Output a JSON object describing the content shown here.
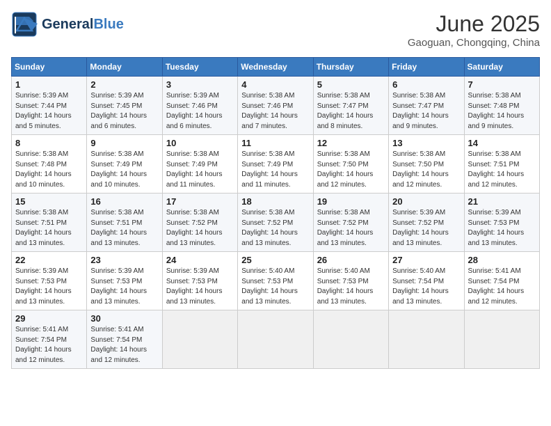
{
  "header": {
    "logo": {
      "general": "General",
      "blue": "Blue"
    },
    "title": "June 2025",
    "location": "Gaoguan, Chongqing, China"
  },
  "calendar": {
    "headers": [
      "Sunday",
      "Monday",
      "Tuesday",
      "Wednesday",
      "Thursday",
      "Friday",
      "Saturday"
    ],
    "weeks": [
      [
        {
          "day": "",
          "info": ""
        },
        {
          "day": "2",
          "info": "Sunrise: 5:39 AM\nSunset: 7:45 PM\nDaylight: 14 hours\nand 6 minutes."
        },
        {
          "day": "3",
          "info": "Sunrise: 5:39 AM\nSunset: 7:46 PM\nDaylight: 14 hours\nand 6 minutes."
        },
        {
          "day": "4",
          "info": "Sunrise: 5:38 AM\nSunset: 7:46 PM\nDaylight: 14 hours\nand 7 minutes."
        },
        {
          "day": "5",
          "info": "Sunrise: 5:38 AM\nSunset: 7:47 PM\nDaylight: 14 hours\nand 8 minutes."
        },
        {
          "day": "6",
          "info": "Sunrise: 5:38 AM\nSunset: 7:47 PM\nDaylight: 14 hours\nand 9 minutes."
        },
        {
          "day": "7",
          "info": "Sunrise: 5:38 AM\nSunset: 7:48 PM\nDaylight: 14 hours\nand 9 minutes."
        }
      ],
      [
        {
          "day": "1",
          "info": "Sunrise: 5:39 AM\nSunset: 7:44 PM\nDaylight: 14 hours\nand 5 minutes.",
          "first": true
        },
        {
          "day": "8",
          "info": "Sunrise: 5:38 AM\nSunset: 7:48 PM\nDaylight: 14 hours\nand 10 minutes."
        },
        {
          "day": "9",
          "info": "Sunrise: 5:38 AM\nSunset: 7:49 PM\nDaylight: 14 hours\nand 10 minutes."
        },
        {
          "day": "10",
          "info": "Sunrise: 5:38 AM\nSunset: 7:49 PM\nDaylight: 14 hours\nand 11 minutes."
        },
        {
          "day": "11",
          "info": "Sunrise: 5:38 AM\nSunset: 7:49 PM\nDaylight: 14 hours\nand 11 minutes."
        },
        {
          "day": "12",
          "info": "Sunrise: 5:38 AM\nSunset: 7:50 PM\nDaylight: 14 hours\nand 12 minutes."
        },
        {
          "day": "13",
          "info": "Sunrise: 5:38 AM\nSunset: 7:50 PM\nDaylight: 14 hours\nand 12 minutes."
        },
        {
          "day": "14",
          "info": "Sunrise: 5:38 AM\nSunset: 7:51 PM\nDaylight: 14 hours\nand 12 minutes."
        }
      ],
      [
        {
          "day": "15",
          "info": "Sunrise: 5:38 AM\nSunset: 7:51 PM\nDaylight: 14 hours\nand 13 minutes."
        },
        {
          "day": "16",
          "info": "Sunrise: 5:38 AM\nSunset: 7:51 PM\nDaylight: 14 hours\nand 13 minutes."
        },
        {
          "day": "17",
          "info": "Sunrise: 5:38 AM\nSunset: 7:52 PM\nDaylight: 14 hours\nand 13 minutes."
        },
        {
          "day": "18",
          "info": "Sunrise: 5:38 AM\nSunset: 7:52 PM\nDaylight: 14 hours\nand 13 minutes."
        },
        {
          "day": "19",
          "info": "Sunrise: 5:38 AM\nSunset: 7:52 PM\nDaylight: 14 hours\nand 13 minutes."
        },
        {
          "day": "20",
          "info": "Sunrise: 5:39 AM\nSunset: 7:52 PM\nDaylight: 14 hours\nand 13 minutes."
        },
        {
          "day": "21",
          "info": "Sunrise: 5:39 AM\nSunset: 7:53 PM\nDaylight: 14 hours\nand 13 minutes."
        }
      ],
      [
        {
          "day": "22",
          "info": "Sunrise: 5:39 AM\nSunset: 7:53 PM\nDaylight: 14 hours\nand 13 minutes."
        },
        {
          "day": "23",
          "info": "Sunrise: 5:39 AM\nSunset: 7:53 PM\nDaylight: 14 hours\nand 13 minutes."
        },
        {
          "day": "24",
          "info": "Sunrise: 5:39 AM\nSunset: 7:53 PM\nDaylight: 14 hours\nand 13 minutes."
        },
        {
          "day": "25",
          "info": "Sunrise: 5:40 AM\nSunset: 7:53 PM\nDaylight: 14 hours\nand 13 minutes."
        },
        {
          "day": "26",
          "info": "Sunrise: 5:40 AM\nSunset: 7:53 PM\nDaylight: 14 hours\nand 13 minutes."
        },
        {
          "day": "27",
          "info": "Sunrise: 5:40 AM\nSunset: 7:54 PM\nDaylight: 14 hours\nand 13 minutes."
        },
        {
          "day": "28",
          "info": "Sunrise: 5:41 AM\nSunset: 7:54 PM\nDaylight: 14 hours\nand 12 minutes."
        }
      ],
      [
        {
          "day": "29",
          "info": "Sunrise: 5:41 AM\nSunset: 7:54 PM\nDaylight: 14 hours\nand 12 minutes."
        },
        {
          "day": "30",
          "info": "Sunrise: 5:41 AM\nSunset: 7:54 PM\nDaylight: 14 hours\nand 12 minutes."
        },
        {
          "day": "",
          "info": ""
        },
        {
          "day": "",
          "info": ""
        },
        {
          "day": "",
          "info": ""
        },
        {
          "day": "",
          "info": ""
        },
        {
          "day": "",
          "info": ""
        }
      ]
    ]
  }
}
